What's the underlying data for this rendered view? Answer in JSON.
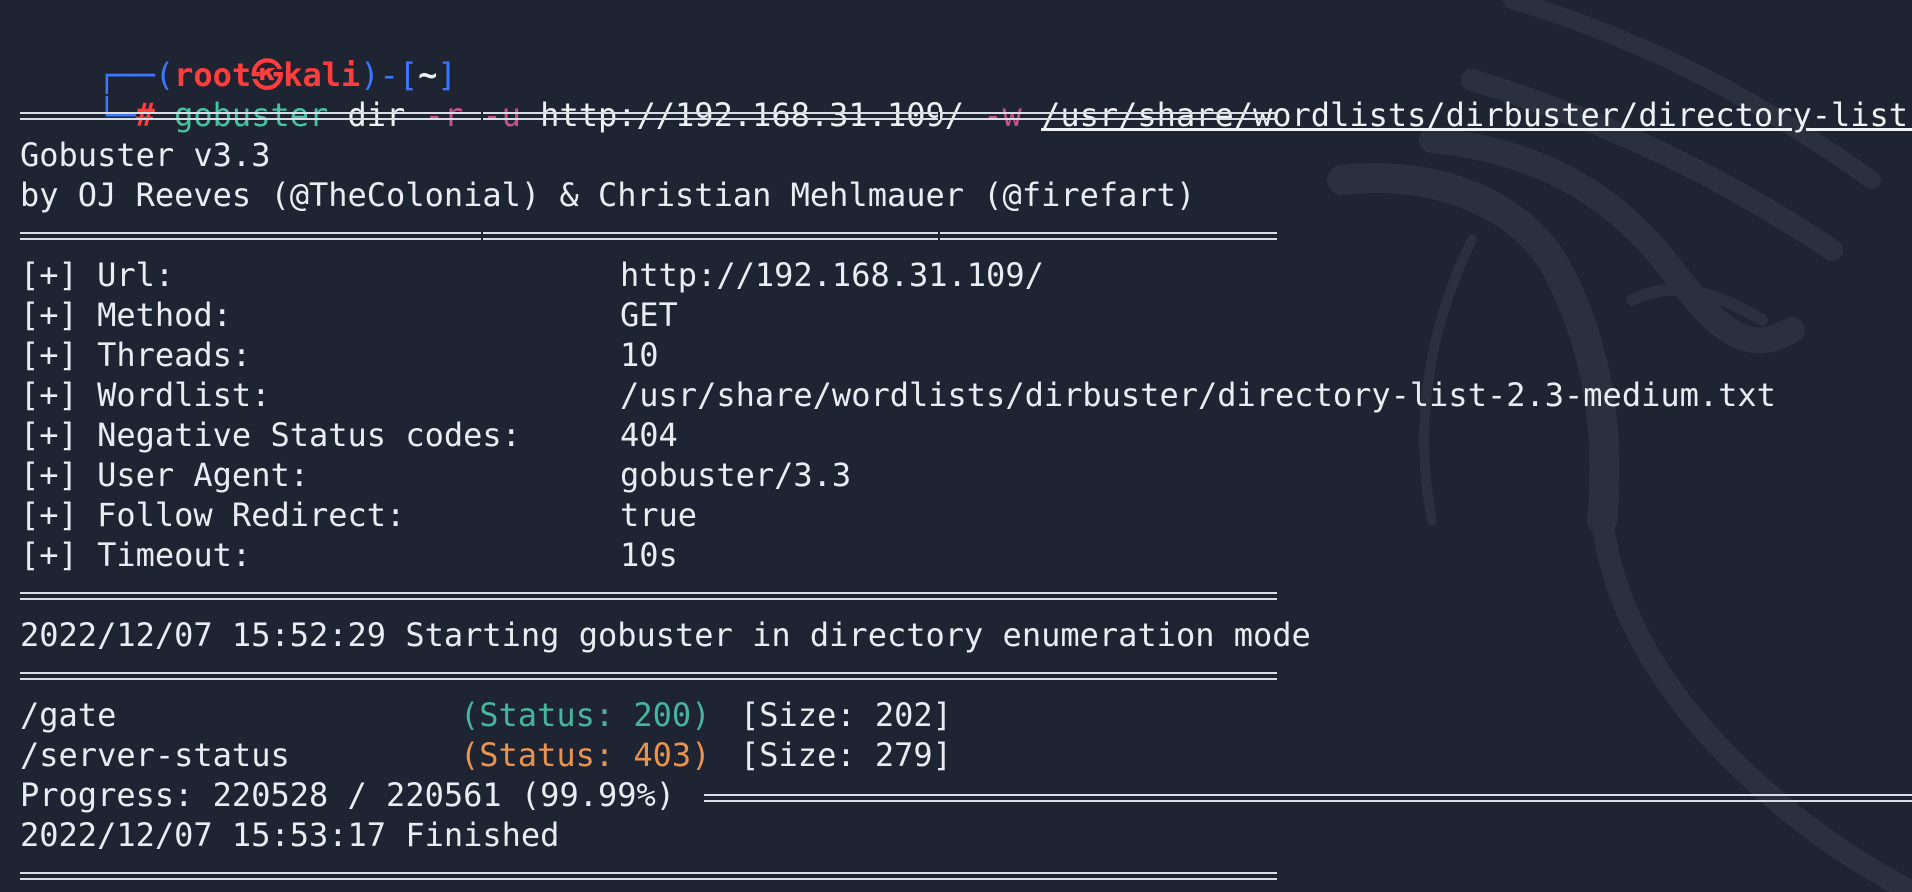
{
  "prompt": {
    "line1_prefix": "┌──(",
    "user": "root㉿kali",
    "line1_mid": ")-[",
    "cwd": "~",
    "line1_suffix": "]",
    "line2_prefix": "└─",
    "symbol": "#"
  },
  "command": {
    "name": "gobuster",
    "subcommand": "dir",
    "flag_r": "-r",
    "flag_u": "-u",
    "url": "http://192.168.31.109/",
    "flag_w": "-w",
    "wordlist": "/usr/share/wordlists/dirbuster/directory-list-"
  },
  "banner": {
    "version": "Gobuster v3.3",
    "authors": "by OJ Reeves (@TheColonial) & Christian Mehlmauer (@firefart)"
  },
  "config": [
    {
      "key": "[+] Url:",
      "value": "http://192.168.31.109/"
    },
    {
      "key": "[+] Method:",
      "value": "GET"
    },
    {
      "key": "[+] Threads:",
      "value": "10"
    },
    {
      "key": "[+] Wordlist:",
      "value": "/usr/share/wordlists/dirbuster/directory-list-2.3-medium.txt"
    },
    {
      "key": "[+] Negative Status codes:",
      "value": "404"
    },
    {
      "key": "[+] User Agent:",
      "value": "gobuster/3.3"
    },
    {
      "key": "[+] Follow Redirect:",
      "value": "true"
    },
    {
      "key": "[+] Timeout:",
      "value": "10s"
    }
  ],
  "start_message": "2022/12/07 15:52:29 Starting gobuster in directory enumeration mode",
  "results": [
    {
      "path": "/gate",
      "status": "(Status: 200)",
      "size": "[Size: 202]"
    },
    {
      "path": "/server-status",
      "status": "(Status: 403)",
      "size": "[Size: 279]"
    }
  ],
  "progress": {
    "text": "Progress: 220528 / 220561 (99.99%)",
    "fraction": 0.9999
  },
  "finish_message": "2022/12/07 15:53:17 Finished",
  "colors": {
    "background": "#1e2431",
    "prompt_frame": "#3b78ff",
    "prompt_user": "#ff3d3d",
    "command_name": "#44c4a2",
    "command_flag": "#c9508c",
    "status_200": "#45b5a1",
    "status_403": "#e9934f"
  },
  "icons": {
    "background_logo": "kali-dragon-icon"
  }
}
